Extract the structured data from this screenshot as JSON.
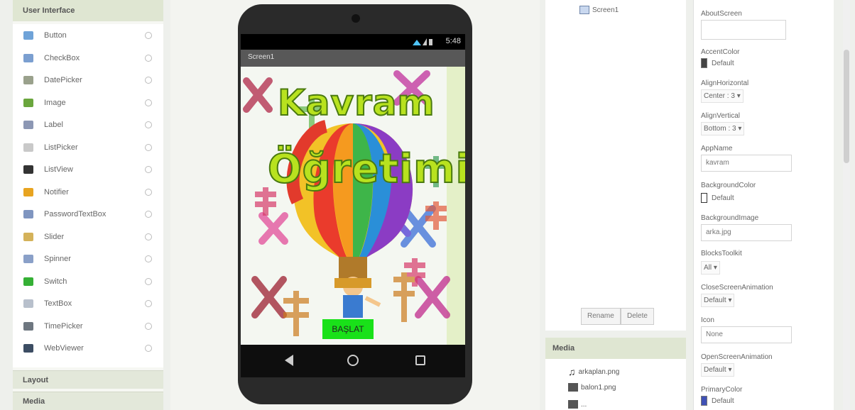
{
  "palette": {
    "header": "User Interface",
    "items": [
      {
        "label": "Button",
        "icon": "button-icon",
        "color": "#6fa3d8"
      },
      {
        "label": "CheckBox",
        "icon": "checkbox-icon",
        "color": "#7b9fd0"
      },
      {
        "label": "DatePicker",
        "icon": "datepicker-icon",
        "color": "#9aa18c"
      },
      {
        "label": "Image",
        "icon": "image-icon",
        "color": "#6aa63d"
      },
      {
        "label": "Label",
        "icon": "label-icon",
        "color": "#8c97b4"
      },
      {
        "label": "ListPicker",
        "icon": "listpicker-icon",
        "color": "#c9c9c9"
      },
      {
        "label": "ListView",
        "icon": "listview-icon",
        "color": "#333333"
      },
      {
        "label": "Notifier",
        "icon": "notifier-icon",
        "color": "#e8a420"
      },
      {
        "label": "PasswordTextBox",
        "icon": "password-icon",
        "color": "#7f95c0"
      },
      {
        "label": "Slider",
        "icon": "slider-icon",
        "color": "#d4b25a"
      },
      {
        "label": "Spinner",
        "icon": "spinner-icon",
        "color": "#8aa0c8"
      },
      {
        "label": "Switch",
        "icon": "switch-icon",
        "color": "#35b035"
      },
      {
        "label": "TextBox",
        "icon": "textbox-icon",
        "color": "#b8c0cc"
      },
      {
        "label": "TimePicker",
        "icon": "timepicker-icon",
        "color": "#6e7780"
      },
      {
        "label": "WebViewer",
        "icon": "webviewer-icon",
        "color": "#3c4d63"
      }
    ],
    "sections": [
      "Layout",
      "Media"
    ]
  },
  "viewer": {
    "status_time": "5:48",
    "screen_title": "Screen1",
    "title_line1": "Kavram",
    "title_line2": "Öğretimi",
    "start_button": "BAŞLAT"
  },
  "components": {
    "root": "Screen1",
    "rename": "Rename",
    "delete": "Delete"
  },
  "media": {
    "header": "Media",
    "items": [
      "arkaplan.png",
      "balon1.png",
      "..."
    ]
  },
  "properties": {
    "about_label": "AboutScreen",
    "accent_label": "AccentColor",
    "accent_value": "Default",
    "accent_color": "#444444",
    "align_h_label": "AlignHorizontal",
    "align_h_value": "Center : 3 ▾",
    "align_v_label": "AlignVertical",
    "align_v_value": "Bottom : 3 ▾",
    "appname_label": "AppName",
    "appname_value": "kavram",
    "bgcolor_label": "BackgroundColor",
    "bgcolor_value": "Default",
    "bgcolor_color": "#ffffff",
    "bgimage_label": "BackgroundImage",
    "bgimage_value": "arka.jpg",
    "blocks_label": "BlocksToolkit",
    "blocks_value": "All ▾",
    "close_label": "CloseScreenAnimation",
    "close_value": "Default ▾",
    "icon_label": "Icon",
    "icon_value": "None",
    "open_label": "OpenScreenAnimation",
    "open_value": "Default ▾",
    "primary_label": "PrimaryColor",
    "primary_value": "Default",
    "primary_color": "#3f51b5"
  }
}
